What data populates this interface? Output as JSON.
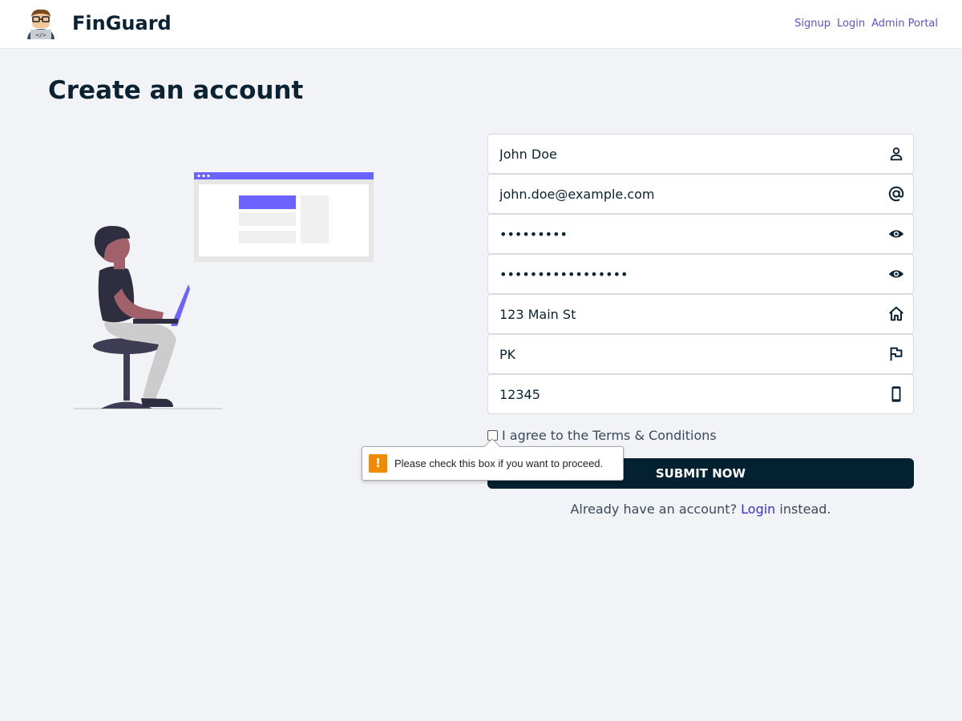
{
  "header": {
    "brand": "FinGuard",
    "nav": [
      "Signup",
      "Login",
      "Admin Portal"
    ]
  },
  "page": {
    "title": "Create an account"
  },
  "form": {
    "fields": [
      {
        "value": "John Doe",
        "type": "text",
        "icon": "user-icon"
      },
      {
        "value": "john.doe@example.com",
        "type": "text",
        "icon": "at-icon"
      },
      {
        "value": "password1",
        "type": "password",
        "icon": "eye-icon"
      },
      {
        "value": "password123456789",
        "type": "password",
        "icon": "eye-icon"
      },
      {
        "value": "123 Main St",
        "type": "text",
        "icon": "home-icon"
      },
      {
        "value": "PK",
        "type": "text",
        "icon": "flag-icon"
      },
      {
        "value": "12345",
        "type": "text",
        "icon": "mobile-icon"
      }
    ],
    "terms_label": "I agree to the Terms & Conditions",
    "validation_message": "Please check this box if you want to proceed.",
    "submit_label": "SUBMIT NOW",
    "login_prefix": "Already have an account?",
    "login_link": "Login",
    "login_suffix": "instead."
  },
  "colors": {
    "accent": "#5b52d6",
    "brand_dark": "#032130",
    "illustration_purple": "#6c63ff",
    "warning": "#f08a00"
  }
}
